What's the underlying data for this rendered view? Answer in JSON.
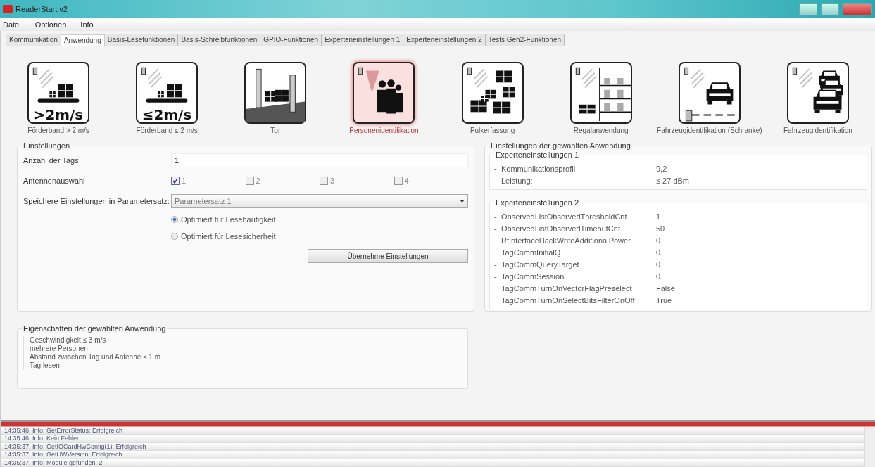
{
  "window": {
    "title": "ReaderStart v2"
  },
  "menu": [
    "Datei",
    "Optionen",
    "Info"
  ],
  "tabs": [
    {
      "label": "Kommunikation",
      "selected": false
    },
    {
      "label": "Anwendung",
      "selected": true
    },
    {
      "label": "Basis-Lesefunktionen",
      "selected": false
    },
    {
      "label": "Basis-Schreibfunktionen",
      "selected": false
    },
    {
      "label": "GPIO-Funktionen",
      "selected": false
    },
    {
      "label": "Experteneinstellungen 1",
      "selected": false
    },
    {
      "label": "Experteneinstellungen 2",
      "selected": false
    },
    {
      "label": "Tests Gen2-Funktionen",
      "selected": false
    }
  ],
  "applications": [
    {
      "kind": "conveyor",
      "badge": ">2m/s",
      "label": "Förderband > 2 m/s",
      "selected": false
    },
    {
      "kind": "conveyor",
      "badge": "≤2m/s",
      "label": "Förderband ≤ 2 m/s",
      "selected": false
    },
    {
      "kind": "gate",
      "label": "Tor",
      "selected": false
    },
    {
      "kind": "people",
      "label": "Personenidentifikation",
      "selected": true
    },
    {
      "kind": "bulk",
      "label": "Pulkerfassung",
      "selected": false
    },
    {
      "kind": "shelf",
      "label": "Regalanwendung",
      "selected": false
    },
    {
      "kind": "barrier",
      "label": "Fahrzeugidentifikation (Schranke)",
      "selected": false
    },
    {
      "kind": "cars",
      "label": "Fahrzeugidentifikation",
      "selected": false
    }
  ],
  "settings": {
    "title": "Einstellungen",
    "tag_count": {
      "label": "Anzahl der Tags",
      "value": "1"
    },
    "antennas": {
      "label": "Antennenauswahl",
      "options": [
        {
          "label": "1",
          "checked": true
        },
        {
          "label": "2",
          "checked": false
        },
        {
          "label": "3",
          "checked": false
        },
        {
          "label": "4",
          "checked": false
        }
      ]
    },
    "parameter_set": {
      "label": "Speichere Einstellungen in Parametersatz:",
      "value": "Parametersatz 1"
    },
    "optimization": [
      {
        "label": "Optimiert für Lesehäufigkeit",
        "selected": true
      },
      {
        "label": "Optimiert für Lesesicherheit",
        "selected": false
      }
    ],
    "apply_button": "Übernehme Einstellungen"
  },
  "application_settings": {
    "title": "Einstellungen der gewählten Anwendung",
    "groups": [
      {
        "title": "Experteneinstellungen 1",
        "rows": [
          {
            "marker": "-",
            "name": "Kommunikationsprofil",
            "value": "9,2"
          },
          {
            "name": "Leistung:",
            "value": "≤ 27 dBm"
          }
        ]
      },
      {
        "title": "Experteneinstellungen 2",
        "rows": [
          {
            "marker": "-",
            "name": "ObservedListObservedThresholdCnt",
            "value": "1"
          },
          {
            "marker": "-",
            "name": "ObservedListObservedTimeoutCnt",
            "value": "50"
          },
          {
            "name": "RfInterfaceHackWriteAdditionalPower",
            "value": "0"
          },
          {
            "name": "TagCommInitialQ",
            "value": "0"
          },
          {
            "marker": "-",
            "name": "TagCommQueryTarget",
            "value": "0"
          },
          {
            "marker": "-",
            "name": "TagCommSession",
            "value": "0"
          },
          {
            "name": "TagCommTurnOnVectorFlagPreselect",
            "value": "False"
          },
          {
            "name": "TagCommTurnOnSelectBitsFilterOnOff",
            "value": "True"
          }
        ]
      }
    ]
  },
  "properties": {
    "title": "Eigenschaften der gewählten Anwendung",
    "items": [
      "Geschwindigkeit ≤ 3 m/s",
      "mehrere Personen",
      "Abstand zwischen Tag und Antenne ≤ 1 m",
      "Tag lesen"
    ]
  },
  "log": [
    "14:35:46: Info: GetErrorStatus: Erfolgreich",
    "14:35:46: Info: Kein Fehler",
    "14:35:37: Info: GetIOCardHwConfig(1): Erfolgreich",
    "14:35:37: Info: GetHWVersion: Erfolgreich",
    "14:35:37: Info: Module gefunden: 2"
  ]
}
